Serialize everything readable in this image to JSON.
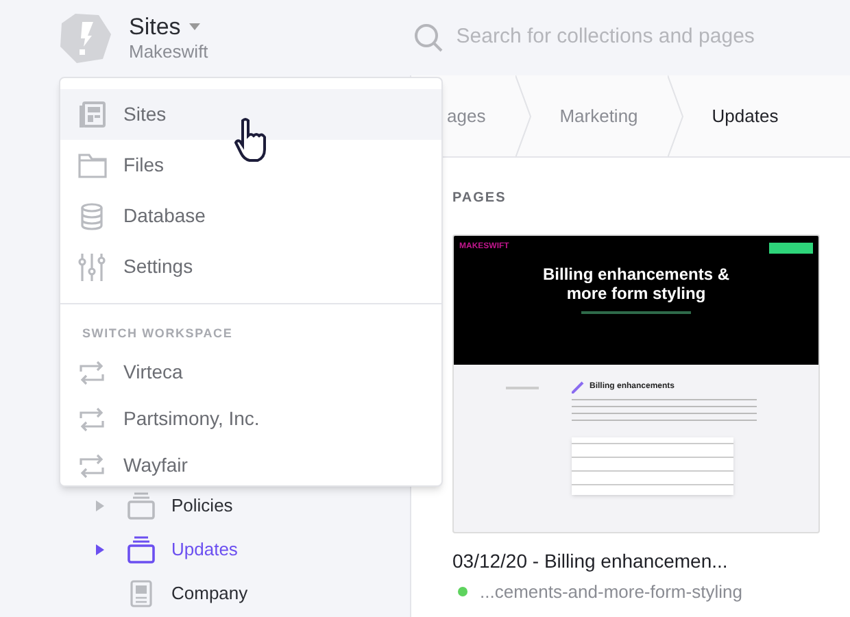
{
  "header": {
    "title": "Sites",
    "subtitle": "Makeswift",
    "search": {
      "placeholder": "Search for collections and pages"
    }
  },
  "breadcrumbs": [
    {
      "label": "ages",
      "selected": false
    },
    {
      "label": "Marketing",
      "selected": false
    },
    {
      "label": "Updates",
      "selected": true
    }
  ],
  "sidebar": {
    "items": [
      {
        "kind": "collection",
        "label": "Policies",
        "selected": false
      },
      {
        "kind": "collection",
        "label": "Updates",
        "selected": true
      },
      {
        "kind": "page",
        "label": "Company",
        "selected": false
      }
    ]
  },
  "dropdown": {
    "items": [
      {
        "kind": "sites",
        "label": "Sites",
        "selected": true
      },
      {
        "kind": "files",
        "label": "Files",
        "selected": false
      },
      {
        "kind": "database",
        "label": "Database",
        "selected": false
      },
      {
        "kind": "settings",
        "label": "Settings",
        "selected": false
      }
    ],
    "section_title": "SWITCH WORKSPACE",
    "workspaces": [
      {
        "label": "Virteca"
      },
      {
        "label": "Partsimony, Inc."
      },
      {
        "label": "Wayfair"
      }
    ]
  },
  "main": {
    "section_title": "PAGES",
    "pages": [
      {
        "title": "03/12/20 - Billing enhancemen...",
        "slug": "...cements-and-more-form-styling",
        "color": "#5ed35e",
        "thumbnail": {
          "brand": "MAKESWIFT",
          "heading": "Billing enhancements & more form styling",
          "subheading": "Billing enhancements"
        }
      }
    ]
  }
}
